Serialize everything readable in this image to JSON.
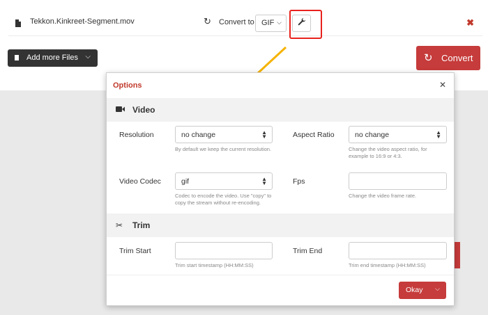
{
  "file_row": {
    "file_name": "Tekkon.Kinkreet-Segment.mov",
    "convert_to_label": "Convert to",
    "format": "GIF",
    "icons": {
      "file": "file-icon",
      "refresh": "refresh-icon",
      "wrench": "wrench-icon",
      "close": "close-icon"
    }
  },
  "actions": {
    "add_files_label": "Add more Files",
    "convert_label": "Convert"
  },
  "colors": {
    "accent": "#c63b3b",
    "highlight": "#e8211d",
    "arrow": "#f5b301",
    "dark_button": "#333333"
  },
  "modal": {
    "title": "Options",
    "video_section": {
      "title": "Video",
      "resolution": {
        "label": "Resolution",
        "value": "no change",
        "help": "By default we keep the current resolution."
      },
      "aspect_ratio": {
        "label": "Aspect Ratio",
        "value": "no change",
        "help": "Change the video aspect ratio, for example to 16:9 or 4:3."
      },
      "video_codec": {
        "label": "Video Codec",
        "value": "gif",
        "help": "Codec to encode the video. Use \"copy\" to copy the stream without re-encoding."
      },
      "fps": {
        "label": "Fps",
        "value": "",
        "help": "Change the video frame rate."
      }
    },
    "trim_section": {
      "title": "Trim",
      "trim_start": {
        "label": "Trim Start",
        "value": "",
        "help": "Trim start timestamp (HH:MM:SS)"
      },
      "trim_end": {
        "label": "Trim End",
        "value": "",
        "help": "Trim end timestamp (HH:MM:SS)"
      }
    },
    "okay_label": "Okay"
  }
}
